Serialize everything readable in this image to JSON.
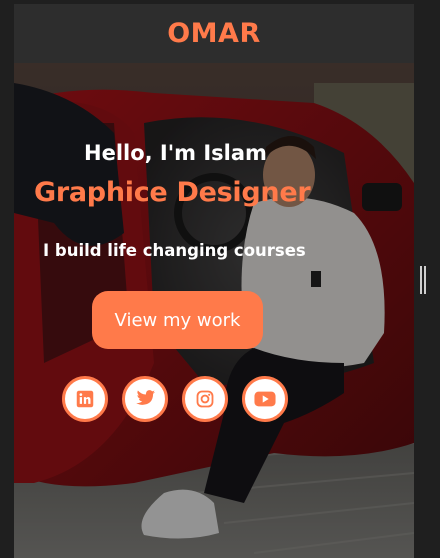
{
  "nav": {
    "brand": "OMAR"
  },
  "hero": {
    "greeting": "Hello, I'm Islam",
    "role": "Graphice Designer",
    "tagline": "I build life changing courses",
    "cta_label": "View my work"
  },
  "social": [
    {
      "icon": "linkedin-icon"
    },
    {
      "icon": "twitter-icon"
    },
    {
      "icon": "instagram-icon"
    },
    {
      "icon": "youtube-icon"
    }
  ],
  "colors": {
    "accent": "#ff7a4a",
    "navbar": "#2d2d2d",
    "text": "#ffffff"
  }
}
